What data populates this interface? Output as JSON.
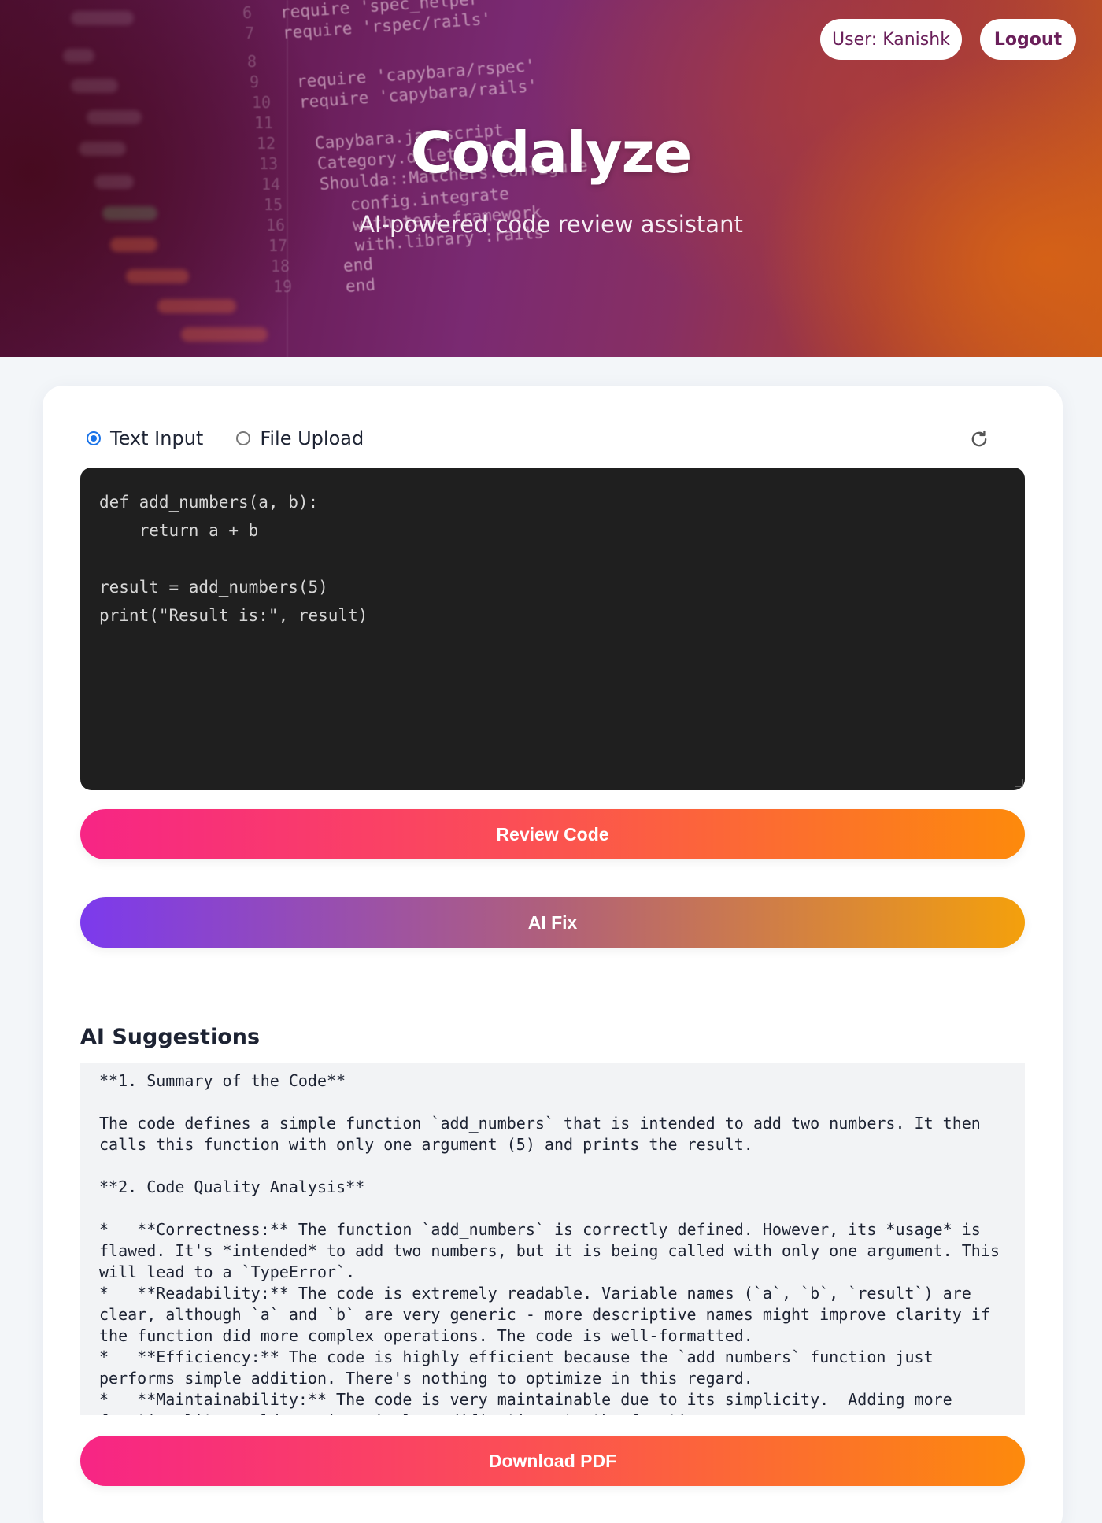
{
  "header": {
    "app_title": "Codalyze",
    "subtitle": "AI-powered code review assistant",
    "user_label": "User: Kanishk",
    "logout_label": "Logout"
  },
  "background_code": {
    "lines": [
      {
        "n": "6",
        "text": "require 'spec_helper'"
      },
      {
        "n": "7",
        "text": "require 'rspec/rails'"
      },
      {
        "n": "8",
        "text": ""
      },
      {
        "n": "9",
        "text": "require 'capybara/rspec'"
      },
      {
        "n": "10",
        "text": "require 'capybara/rails'"
      },
      {
        "n": "11",
        "text": ""
      },
      {
        "n": "12",
        "text": "Capybara.javascript_"
      },
      {
        "n": "13",
        "text": "Category.delete_all;"
      },
      {
        "n": "14",
        "text": "Shoulda::Matchers.configure"
      },
      {
        "n": "15",
        "text": "config.integrate"
      },
      {
        "n": "16",
        "text": "with.test_framework"
      },
      {
        "n": "17",
        "text": "with.library :rails"
      },
      {
        "n": "18",
        "text": "end"
      },
      {
        "n": "19",
        "text": "end"
      }
    ]
  },
  "input_mode": {
    "options": [
      "Text Input",
      "File Upload"
    ],
    "selected": "Text Input",
    "refresh_icon": "refresh-icon"
  },
  "editor": {
    "code": "def add_numbers(a, b):\n    return a + b\n\nresult = add_numbers(5)\nprint(\"Result is:\", result)"
  },
  "actions": {
    "review_label": "Review Code",
    "fix_label": "AI Fix",
    "download_label": "Download PDF"
  },
  "suggestions": {
    "title": "AI Suggestions",
    "text": "**1. Summary of the Code**\n\nThe code defines a simple function `add_numbers` that is intended to add two numbers. It then calls this function with only one argument (5) and prints the result.\n\n**2. Code Quality Analysis**\n\n*   **Correctness:** The function `add_numbers` is correctly defined. However, its *usage* is flawed. It's *intended* to add two numbers, but it is being called with only one argument. This will lead to a `TypeError`.\n*   **Readability:** The code is extremely readable. Variable names (`a`, `b`, `result`) are clear, although `a` and `b` are very generic - more descriptive names might improve clarity if the function did more complex operations. The code is well-formatted.\n*   **Efficiency:** The code is highly efficient because the `add_numbers` function just performs simple addition. There's nothing to optimize in this regard.\n*   **Maintainability:** The code is very maintainable due to its simplicity.  Adding more functionality would require simple modifications to the function."
  },
  "colors": {
    "accent_pink": "#f72585",
    "accent_orange": "#fd8a0c",
    "accent_purple": "#7c3aed",
    "radio_blue": "#1a73e8",
    "editor_bg": "#1f1f1f"
  }
}
